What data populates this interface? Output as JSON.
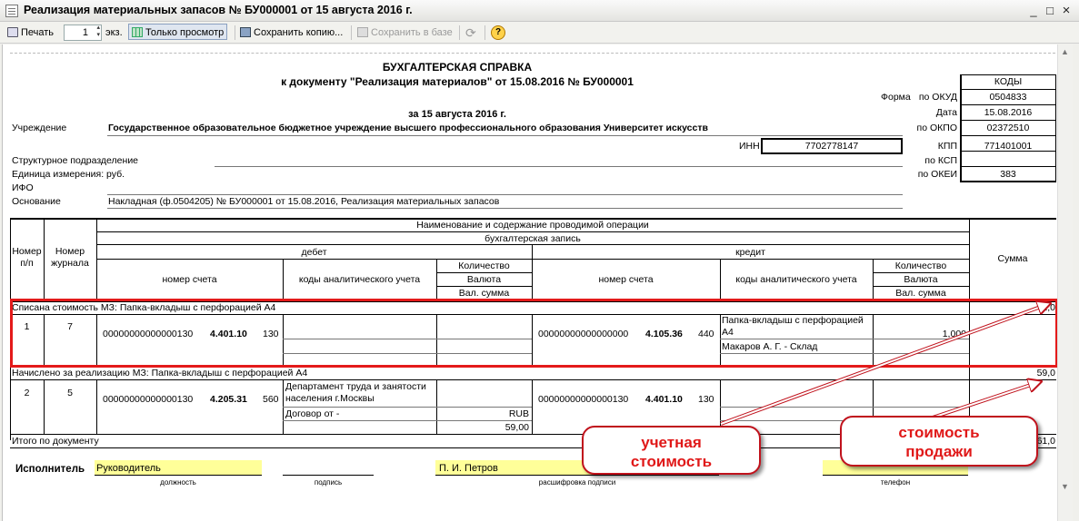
{
  "window": {
    "title": "Реализация материальных запасов № БУ000001 от 15 августа 2016 г.",
    "min_label": "_",
    "max_label": "□",
    "close_label": "×"
  },
  "toolbar": {
    "print_label": "Печать",
    "copies_value": "1",
    "copies_unit": "экз.",
    "view_only_label": "Только просмотр",
    "save_copy_label": "Сохранить копию...",
    "save_db_label": "Сохранить в базе",
    "help_label": "?"
  },
  "doc": {
    "title": "БУХГАЛТЕРСКАЯ СПРАВКА",
    "subtitle": "к документу \"Реализация материалов\" от 15.08.2016 № БУ000001",
    "date_line": "за 15 августа 2016 г.",
    "codes_header": "КОДЫ",
    "forma_label": "Форма",
    "okud_label": "по ОКУД",
    "okud_value": "0504833",
    "date_label": "Дата",
    "date_value": "15.08.2016",
    "okpo_label": "по ОКПО",
    "okpo_value": "02372510",
    "inn_label": "ИНН",
    "inn_value": "7702778147",
    "kpp_label": "КПП",
    "kpp_value": "771401001",
    "ksp_label": "по КСП",
    "okei_label": "по ОКЕИ",
    "okei_value": "383",
    "institution_label": "Учреждение",
    "institution_value": "Государственное образовательное бюджетное учреждение высшего профессионального образования Университет искусств",
    "division_label": "Структурное подразделение",
    "unit_label": "Единица измерения: руб.",
    "ifo_label": "ИФО",
    "basis_label": "Основание",
    "basis_value": "Накладная (ф.0504205) № БУ000001 от 15.08.2016, Реализация материальных запасов"
  },
  "table": {
    "op_header": "Наименование и содержание проводимой операции",
    "entry_header": "бухгалтерская запись",
    "debit_header": "дебет",
    "credit_header": "кредит",
    "num_header": "Номер п/п",
    "journal_header": "Номер журнала",
    "account_header": "номер счета",
    "analytic_header": "коды аналитического учета",
    "qty_header": "Количество",
    "currency_header": "Валюта",
    "cur_sum_header": "Вал. сумма",
    "sum_header": "Сумма",
    "rows": [
      {
        "section": "Списана стоимость МЗ: Папка-вкладыш с перфорацией А4",
        "total": "2,0",
        "num": "1",
        "journal": "7",
        "debit_account_pre": "00000000000000130",
        "debit_account_main": "4.401.10",
        "debit_account_post": "130",
        "credit_account_pre": "00000000000000000",
        "credit_account_main": "4.105.36",
        "credit_account_post": "440",
        "credit_analytic_1": "Папка-вкладыш с перфорацией А4",
        "credit_qty": "1,000",
        "credit_analytic_2": "Макаров А. Г. - Склад"
      },
      {
        "section": "Начислено за реализацию МЗ: Папка-вкладыш с перфорацией А4",
        "total": "59,0",
        "num": "2",
        "journal": "5",
        "debit_account_pre": "00000000000000130",
        "debit_account_main": "4.205.31",
        "debit_account_post": "560",
        "debit_analytic_1": "Департамент труда и занятости населения г.Москвы",
        "debit_analytic_2": "Договор от -",
        "debit_currency": "RUB",
        "debit_cur_sum": "59,00",
        "credit_account_pre": "00000000000000130",
        "credit_account_main": "4.401.10",
        "credit_account_post": "130"
      }
    ],
    "total_label": "Итого по документу",
    "total_value": "61,0"
  },
  "signature": {
    "executor_label": "Исполнитель",
    "position_value": "Руководитель",
    "name_value": "П. И. Петров",
    "position_caption": "должность",
    "sign_caption": "подпись",
    "decode_caption": "расшифровка подписи",
    "phone_caption": "телефон"
  },
  "callouts": {
    "cost_label": "учетная стоимость",
    "sale_label": "стоимость продажи"
  },
  "colors": {
    "highlight_border": "#e41a1a",
    "callout_text": "#e01818",
    "signature_fill": "#ffff99"
  }
}
